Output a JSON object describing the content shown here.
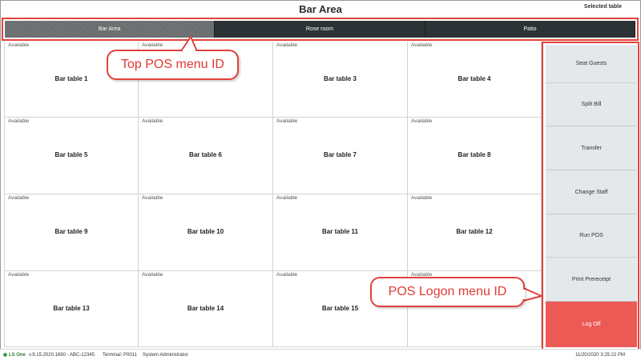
{
  "header": {
    "title": "Bar Area",
    "selected_label": "Selected table"
  },
  "tabs": [
    {
      "label": "Bar Area",
      "active": true
    },
    {
      "label": "Rose room",
      "active": false
    },
    {
      "label": "Patio",
      "active": false
    }
  ],
  "tables": [
    {
      "status": "Available",
      "name": "Bar table 1"
    },
    {
      "status": "Available",
      "name": ""
    },
    {
      "status": "Available",
      "name": "Bar table 3"
    },
    {
      "status": "Available",
      "name": "Bar table 4"
    },
    {
      "status": "Available",
      "name": "Bar table 5"
    },
    {
      "status": "Available",
      "name": "Bar table 6"
    },
    {
      "status": "Available",
      "name": "Bar table 7"
    },
    {
      "status": "Available",
      "name": "Bar table 8"
    },
    {
      "status": "Available",
      "name": "Bar table 9"
    },
    {
      "status": "Available",
      "name": "Bar table 10"
    },
    {
      "status": "Available",
      "name": "Bar table 11"
    },
    {
      "status": "Available",
      "name": "Bar table 12"
    },
    {
      "status": "Available",
      "name": "Bar table 13"
    },
    {
      "status": "Available",
      "name": "Bar table 14"
    },
    {
      "status": "Available",
      "name": "Bar table 15"
    },
    {
      "status": "Available",
      "name": ""
    }
  ],
  "side_menu": [
    {
      "label": "Seat Guests"
    },
    {
      "label": "Split Bill"
    },
    {
      "label": "Transfer"
    },
    {
      "label": "Change Staff"
    },
    {
      "label": "Run POS"
    },
    {
      "label": "Print Prereceipt"
    },
    {
      "label": "Log Off"
    }
  ],
  "callouts": {
    "top": "Top POS menu ID",
    "side": "POS Logon menu ID"
  },
  "status_bar": {
    "brand": "LS One",
    "version": "v.9.15.2020.1690 - ABC-12345",
    "terminal": "Terminal: P0011",
    "user": "System Administrator",
    "datetime": "11/20/2020 3:25:22 PM"
  },
  "colors": {
    "annotation": "#e2413b",
    "tab_dark": "#2b3336",
    "logoff": "#ec5a55",
    "side_button": "#e4e8ea"
  }
}
